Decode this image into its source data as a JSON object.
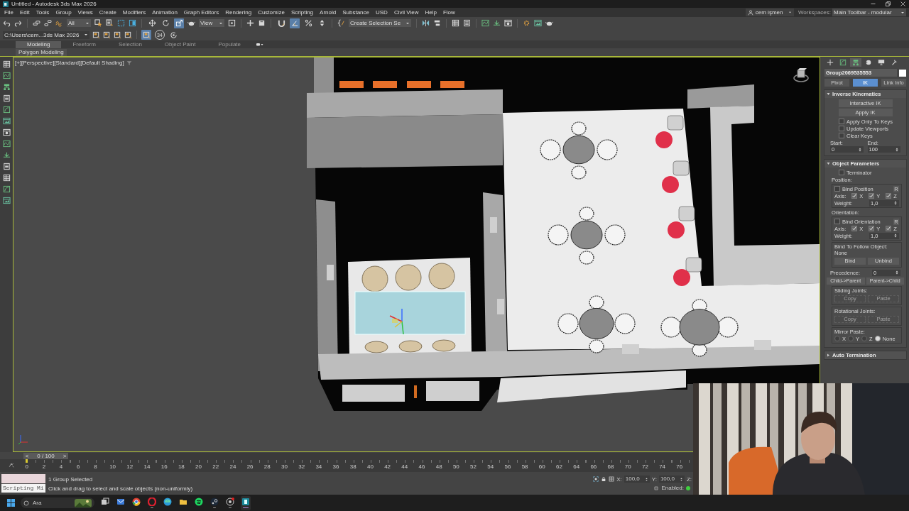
{
  "window": {
    "title": "Untitled - Autodesk 3ds Max 2026"
  },
  "menu": [
    "File",
    "Edit",
    "Tools",
    "Group",
    "Views",
    "Create",
    "Modifiers",
    "Animation",
    "Graph Editors",
    "Rendering",
    "Customize",
    "Scripting",
    "Arnold",
    "Substance",
    "USD",
    "Civil View",
    "Help",
    "Flow"
  ],
  "account": {
    "user": "cem işmen",
    "workspaces_label": "Workspaces:",
    "workspace": "Main Toolbar - modular"
  },
  "main_toolbar": {
    "selection_filter": "All",
    "transform_tools": [
      {
        "selected": false
      },
      {
        "selected": false
      },
      {
        "selected": true
      }
    ],
    "reference_coordinate_system": "View",
    "snap_tools": [
      {
        "selected": false
      },
      {
        "selected": true
      },
      {
        "selected": false
      },
      {
        "selected": false
      }
    ],
    "named_selection_set": "Create Selection Se"
  },
  "project_toolbar": {
    "project_path": "C:\\Users\\cem...3ds Max 2026",
    "tools": [
      {
        "selected": true
      },
      {
        "selected": false,
        "label": "34"
      },
      {
        "selected": false
      }
    ]
  },
  "ribbon": {
    "tabs": [
      {
        "label": "Modeling",
        "selected": true
      },
      {
        "label": "Freeform",
        "selected": false
      },
      {
        "label": "Selection",
        "selected": false
      },
      {
        "label": "Object Paint",
        "selected": false
      },
      {
        "label": "Populate",
        "selected": false
      }
    ],
    "panel": "Polygon Modeling"
  },
  "viewport": {
    "label": "[+][Perspective][Standard][Default Shading]"
  },
  "command_panel": {
    "tabs": [
      {
        "selected": false
      },
      {
        "selected": false
      },
      {
        "selected": true
      },
      {
        "selected": false
      },
      {
        "selected": false
      },
      {
        "selected": false
      }
    ],
    "object_name": "Group2069535553",
    "subtabs": [
      {
        "label": "Pivot",
        "selected": false
      },
      {
        "label": "IK",
        "selected": true
      },
      {
        "label": "Link Info",
        "selected": false
      }
    ],
    "inverse_kinematics": {
      "title": "Inverse Kinematics",
      "expanded": true,
      "buttons": [
        "Interactive IK",
        "Apply IK"
      ],
      "options": [
        {
          "label": "Apply Only To Keys",
          "checked": false
        },
        {
          "label": "Update Viewports",
          "checked": false
        },
        {
          "label": "Clear Keys",
          "checked": false
        }
      ],
      "start_label": "Start:",
      "start": "0",
      "end_label": "End:",
      "end": "100"
    },
    "object_parameters": {
      "title": "Object Parameters",
      "expanded": true,
      "terminator": {
        "label": "Terminator",
        "checked": false
      },
      "groups": [
        {
          "title": "Position:",
          "bind": {
            "label": "Bind Position",
            "checked": false
          },
          "r_button": "R",
          "axis_label": "Axis:",
          "axes": [
            {
              "label": "X",
              "checked": true
            },
            {
              "label": "Y",
              "checked": true
            },
            {
              "label": "Z",
              "checked": true
            }
          ],
          "weight_label": "Weight:",
          "weight": "1,0"
        },
        {
          "title": "Orientation:",
          "bind": {
            "label": "Bind Orientation",
            "checked": false
          },
          "r_button": "R",
          "axis_label": "Axis:",
          "axes": [
            {
              "label": "X",
              "checked": true
            },
            {
              "label": "Y",
              "checked": true
            },
            {
              "label": "Z",
              "checked": true
            }
          ],
          "weight_label": "Weight:",
          "weight": "1,0"
        }
      ],
      "follow": {
        "title": "Bind To Follow Object:",
        "target": "None",
        "buttons": [
          "Bind",
          "Unbind"
        ]
      },
      "precedence_label": "Precedence:",
      "precedence": "0",
      "direction_buttons": [
        "Child->Parent",
        "Parent->Child"
      ],
      "joint_groups": [
        {
          "title": "Sliding Joints:",
          "buttons": [
            {
              "label": "Copy",
              "disabled": true
            },
            {
              "label": "Paste",
              "disabled": true
            }
          ]
        },
        {
          "title": "Rotational Joints:",
          "buttons": [
            {
              "label": "Copy",
              "disabled": true
            },
            {
              "label": "Paste",
              "disabled": true
            }
          ]
        }
      ],
      "mirror_paste": {
        "title": "Mirror Paste:",
        "options": [
          {
            "label": "X",
            "selected": false
          },
          {
            "label": "Y",
            "selected": false
          },
          {
            "label": "Z",
            "selected": false
          },
          {
            "label": "None",
            "selected": true
          }
        ]
      }
    },
    "auto_termination": {
      "title": "Auto Termination",
      "expanded": false
    }
  },
  "time_slider": {
    "prev": "<",
    "label": "0 / 100",
    "next": ">",
    "level": 0
  },
  "track_labels": [
    "0",
    "2",
    "4",
    "6",
    "8",
    "10",
    "12",
    "14",
    "16",
    "18",
    "20",
    "22",
    "24",
    "26",
    "28",
    "30",
    "32",
    "34",
    "36",
    "38",
    "40",
    "42",
    "44",
    "46",
    "48",
    "50",
    "52",
    "54",
    "56",
    "58",
    "60",
    "62",
    "64",
    "66",
    "68",
    "70",
    "72",
    "74",
    "76"
  ],
  "status_bar": {
    "mini_listener": "Scripting Mi",
    "prompt_lines": [
      "1 Group Selected",
      "Click and drag to select and scale objects (non-uniformly)"
    ],
    "transform_fields": [
      {
        "label": "X:",
        "value": "100,0"
      },
      {
        "label": "Y:",
        "value": "100,0"
      },
      {
        "label": "Z:"
      }
    ],
    "enabled_label": "Enabled:"
  },
  "taskbar": {
    "search": {
      "placeholder": "Ara"
    },
    "apps": [
      {
        "running": false,
        "selected": false
      },
      {
        "running": false,
        "selected": false
      },
      {
        "running": false,
        "selected": false
      },
      {
        "running": true,
        "selected": false
      },
      {
        "running": false,
        "selected": false
      },
      {
        "running": false,
        "selected": false
      },
      {
        "running": false,
        "selected": false
      },
      {
        "running": true,
        "selected": false
      },
      {
        "running": true,
        "selected": false
      },
      {
        "running": true,
        "selected": true
      }
    ]
  }
}
